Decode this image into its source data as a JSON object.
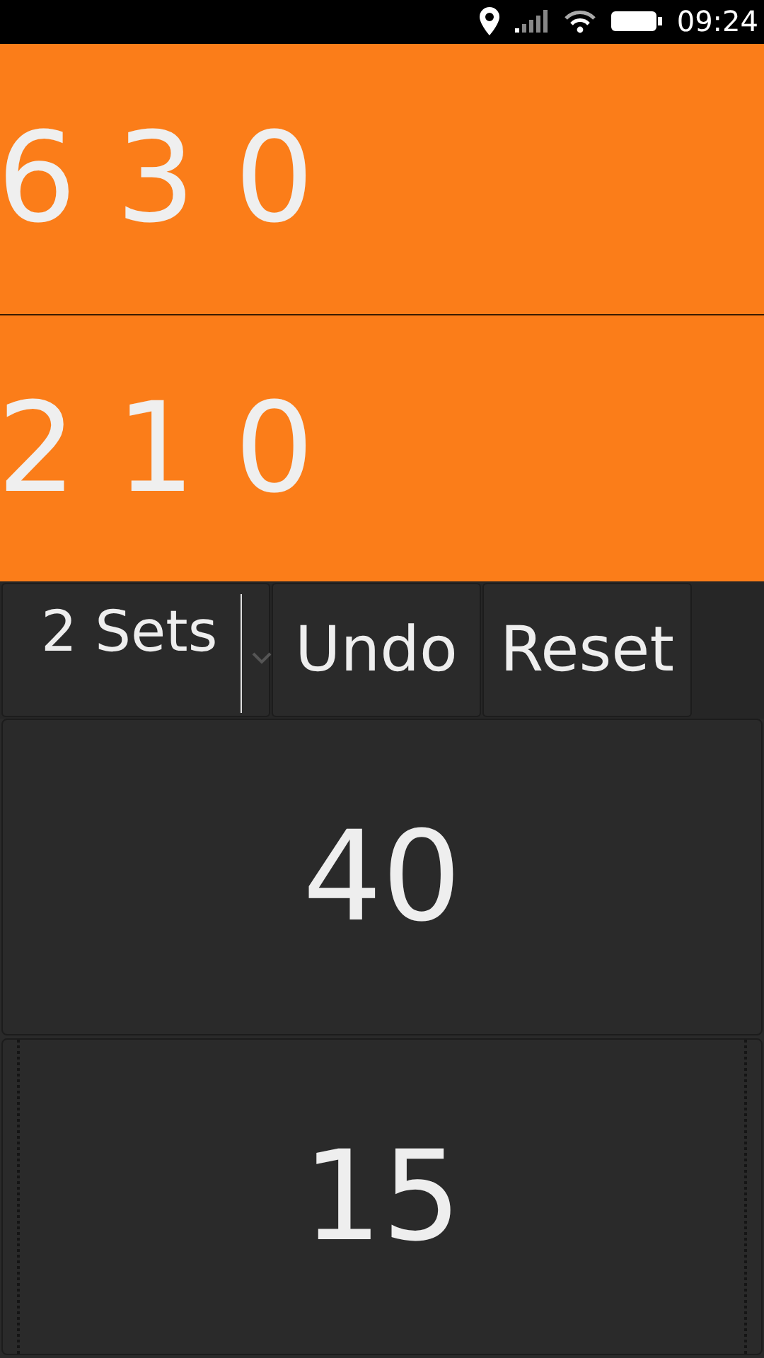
{
  "status_bar": {
    "time": "09:24"
  },
  "scores": [
    "6 3 0",
    "2 1 0"
  ],
  "toolbar": {
    "sets_select": {
      "value": "2 Sets"
    },
    "buttons": [
      "Undo",
      "Reset"
    ]
  },
  "point_buttons": [
    {
      "label": "40",
      "focused": false
    },
    {
      "label": "15",
      "focused": true
    }
  ]
}
